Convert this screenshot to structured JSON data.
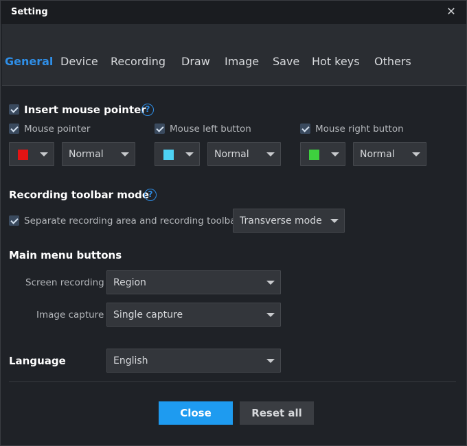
{
  "window": {
    "title": "Setting",
    "close_symbol": "✕"
  },
  "tabs": [
    {
      "label": "General",
      "active": true
    },
    {
      "label": "Device"
    },
    {
      "label": "Recording"
    },
    {
      "label": "Draw"
    },
    {
      "label": "Image"
    },
    {
      "label": "Save"
    },
    {
      "label": "Hot keys"
    },
    {
      "label": "Others"
    }
  ],
  "mouse": {
    "title": "Insert mouse pointer",
    "help": "?",
    "pointer": {
      "label": "Mouse pointer",
      "color": "#e31414",
      "mode": "Normal"
    },
    "left": {
      "label": "Mouse left button",
      "color": "#4dd2f4",
      "mode": "Normal"
    },
    "right": {
      "label": "Mouse right button",
      "color": "#3ed13e",
      "mode": "Normal"
    }
  },
  "toolbar": {
    "title": "Recording toolbar mode",
    "help": "?",
    "separate_label": "Separate recording area and recording toolbar",
    "mode": "Transverse mode"
  },
  "main_menu": {
    "title": "Main menu buttons",
    "screen_label": "Screen recording",
    "screen_value": "Region",
    "image_label": "Image capture",
    "image_value": "Single capture"
  },
  "language": {
    "title": "Language",
    "value": "English"
  },
  "buttons": {
    "close": "Close",
    "reset": "Reset all"
  },
  "colors": {
    "accent": "#2f8fe8",
    "primary_button": "#1e9bf0"
  }
}
